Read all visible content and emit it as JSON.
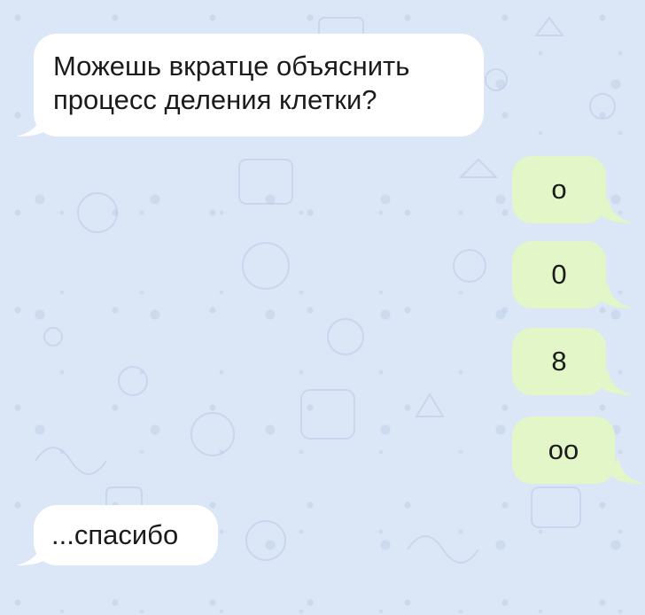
{
  "messages": [
    {
      "id": "m1",
      "direction": "incoming",
      "text": "Можешь вкратце объяснить процесс деления клетки?"
    },
    {
      "id": "m2",
      "direction": "outgoing",
      "text": "о"
    },
    {
      "id": "m3",
      "direction": "outgoing",
      "text": "0"
    },
    {
      "id": "m4",
      "direction": "outgoing",
      "text": "8"
    },
    {
      "id": "m5",
      "direction": "outgoing",
      "text": "оо"
    },
    {
      "id": "m6",
      "direction": "incoming",
      "text": "...спасибо"
    }
  ],
  "colors": {
    "background": "#dbe6f7",
    "incoming_bubble": "#ffffff",
    "outgoing_bubble": "#e2f6c8",
    "text": "#1b1b1b"
  }
}
